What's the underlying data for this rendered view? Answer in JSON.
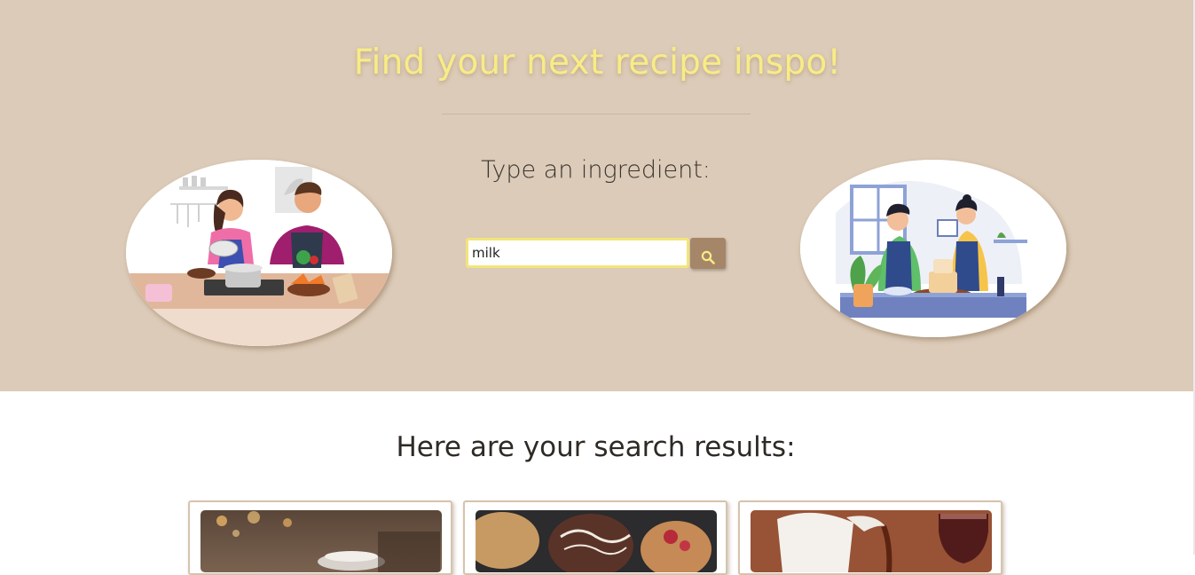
{
  "hero": {
    "title": "Find your next recipe inspo!",
    "prompt": "Type an ingredient:",
    "illustrations": [
      "couple-cooking-illustration",
      "couple-baking-cake-illustration"
    ]
  },
  "search": {
    "value": "milk",
    "placeholder": "",
    "button_icon": "search-icon"
  },
  "results": {
    "heading": "Here are your search results:",
    "cards": [
      {
        "image": "coffee-cup-bokeh-photo"
      },
      {
        "image": "glazed-pastries-photo"
      },
      {
        "image": "milk-jug-pouring-photo"
      }
    ]
  },
  "colors": {
    "hero_background": "#dccbb8",
    "title_color": "#f7ec86",
    "input_border": "#f2e57a",
    "button_background": "#a68669",
    "card_border": "#d6c3ad"
  }
}
